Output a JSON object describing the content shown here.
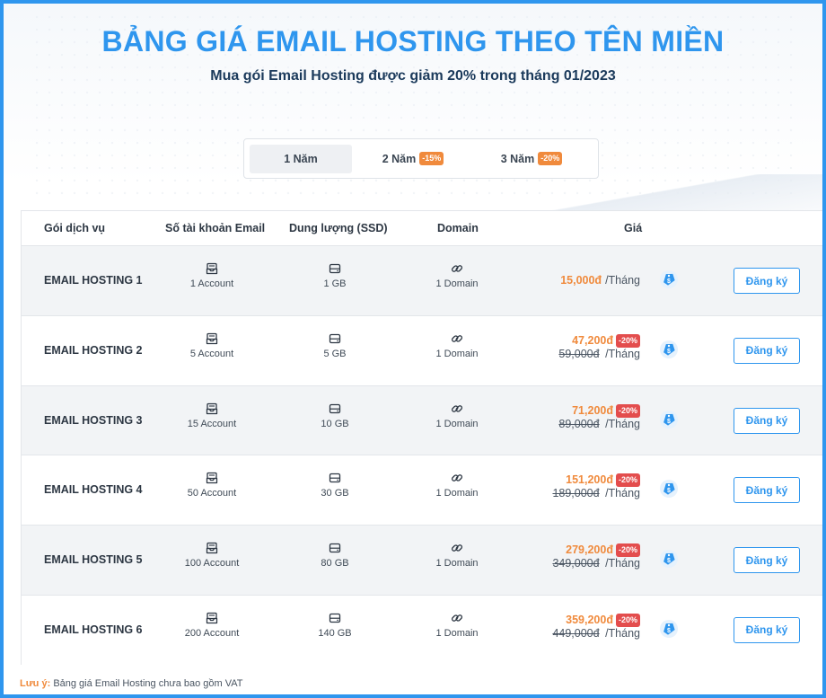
{
  "header": {
    "title": "BẢNG GIÁ EMAIL HOSTING THEO TÊN MIỀN",
    "subtitle": "Mua gói Email Hosting được giảm 20% trong tháng 01/2023"
  },
  "tabs": [
    {
      "label": "1 Năm",
      "badge": "",
      "active": true
    },
    {
      "label": "2 Năm",
      "badge": "-15%",
      "active": false
    },
    {
      "label": "3 Năm",
      "badge": "-20%",
      "active": false
    }
  ],
  "table": {
    "headers": {
      "service": "Gói dịch vụ",
      "accounts": "Số tài khoản Email",
      "storage": "Dung lượng (SSD)",
      "domain": "Domain",
      "price": "Giá"
    },
    "rows": [
      {
        "name": "EMAIL HOSTING 1",
        "accounts": "1 Account",
        "storage": "1 GB",
        "domain": "1 Domain",
        "price": "15,000đ",
        "discount": "",
        "old_price": "",
        "per": "/Tháng",
        "cta": "Đăng ký"
      },
      {
        "name": "EMAIL HOSTING 2",
        "accounts": "5 Account",
        "storage": "5 GB",
        "domain": "1 Domain",
        "price": "47,200đ",
        "discount": "-20%",
        "old_price": "59,000đ",
        "per": "/Tháng",
        "cta": "Đăng ký"
      },
      {
        "name": "EMAIL HOSTING 3",
        "accounts": "15 Account",
        "storage": "10 GB",
        "domain": "1 Domain",
        "price": "71,200đ",
        "discount": "-20%",
        "old_price": "89,000đ",
        "per": "/Tháng",
        "cta": "Đăng ký"
      },
      {
        "name": "EMAIL HOSTING 4",
        "accounts": "50 Account",
        "storage": "30 GB",
        "domain": "1 Domain",
        "price": "151,200đ",
        "discount": "-20%",
        "old_price": "189,000đ",
        "per": "/Tháng",
        "cta": "Đăng ký"
      },
      {
        "name": "EMAIL HOSTING 5",
        "accounts": "100 Account",
        "storage": "80 GB",
        "domain": "1 Domain",
        "price": "279,200đ",
        "discount": "-20%",
        "old_price": "349,000đ",
        "per": "/Tháng",
        "cta": "Đăng ký"
      },
      {
        "name": "EMAIL HOSTING 6",
        "accounts": "200 Account",
        "storage": "140 GB",
        "domain": "1 Domain",
        "price": "359,200đ",
        "discount": "-20%",
        "old_price": "449,000đ",
        "per": "/Tháng",
        "cta": "Đăng ký"
      }
    ]
  },
  "note": {
    "label": "Lưu ý:",
    "text": "Bảng giá Email Hosting chưa bao gồm VAT"
  },
  "colors": {
    "accent": "#2f96ee",
    "price": "#f08a3c",
    "discount_badge": "#e34d4d",
    "heading": "#1b3a5b"
  },
  "icons": {
    "accounts": "mail-inbox-icon",
    "storage": "hard-drive-icon",
    "domain": "link-icon",
    "tag": "price-tag-icon"
  }
}
